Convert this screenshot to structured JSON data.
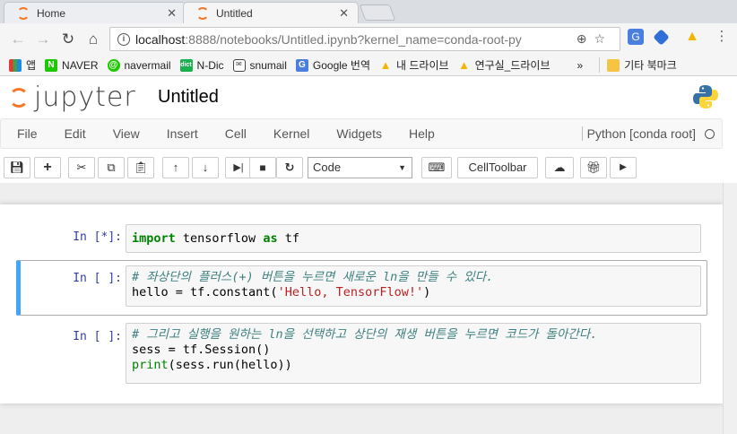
{
  "browser": {
    "tabs": [
      {
        "label": "Home",
        "active": false
      },
      {
        "label": "Untitled",
        "active": true
      }
    ],
    "address": {
      "host": "localhost",
      "path": ":8888/notebooks/Untitled.ipynb?kernel_name=conda-root-py"
    },
    "bookmarks": [
      {
        "label": "앱",
        "icon": "apps-grid-icon"
      },
      {
        "label": "NAVER",
        "icon": "naver-icon"
      },
      {
        "label": "navermail",
        "icon": "navermail-icon"
      },
      {
        "label": "N-Dic",
        "icon": "ndic-icon"
      },
      {
        "label": "snumail",
        "icon": "mail-icon"
      },
      {
        "label": "Google 번역",
        "icon": "google-translate-icon"
      },
      {
        "label": "내 드라이브",
        "icon": "drive-icon"
      },
      {
        "label": "연구실_드라이브",
        "icon": "drive-icon"
      }
    ],
    "bookmarks_more": "»",
    "other_bookmarks": "기타 북마크"
  },
  "jupyter": {
    "logo_text": "jupyter",
    "notebook_title": "Untitled",
    "menu": [
      "File",
      "Edit",
      "View",
      "Insert",
      "Cell",
      "Kernel",
      "Widgets",
      "Help"
    ],
    "kernel_name": "Python [conda root]",
    "toolbar": {
      "cell_type": "Code",
      "celltoolbar_label": "CellToolbar"
    },
    "cells": [
      {
        "prompt": "In [*]:"
      },
      {
        "prompt": "In [ ]:"
      },
      {
        "prompt": "In [ ]:"
      }
    ],
    "code": {
      "c1_import": "import",
      "c1_mod": " tensorflow ",
      "c1_as": "as",
      "c1_alias": " tf",
      "c2_comment": "# 좌상단의 플러스(+) 버튼을 누르면 새로운 ln을 만들 수 있다.",
      "c2_line2_a": "hello = tf.constant(",
      "c2_line2_str": "'Hello, TensorFlow!'",
      "c2_line2_b": ")",
      "c3_comment": "# 그리고 실행을 원하는 ln을 선택하고 상단의 재생 버튼을 누르면 코드가 돌아간다.",
      "c3_line2": "sess = tf.Session()",
      "c3_print": "print",
      "c3_line3_rest": "(sess.run(hello))"
    }
  },
  "colors": {
    "accent": "#f37726",
    "selected_border": "#42a5f5",
    "prompt": "#303f9f"
  }
}
